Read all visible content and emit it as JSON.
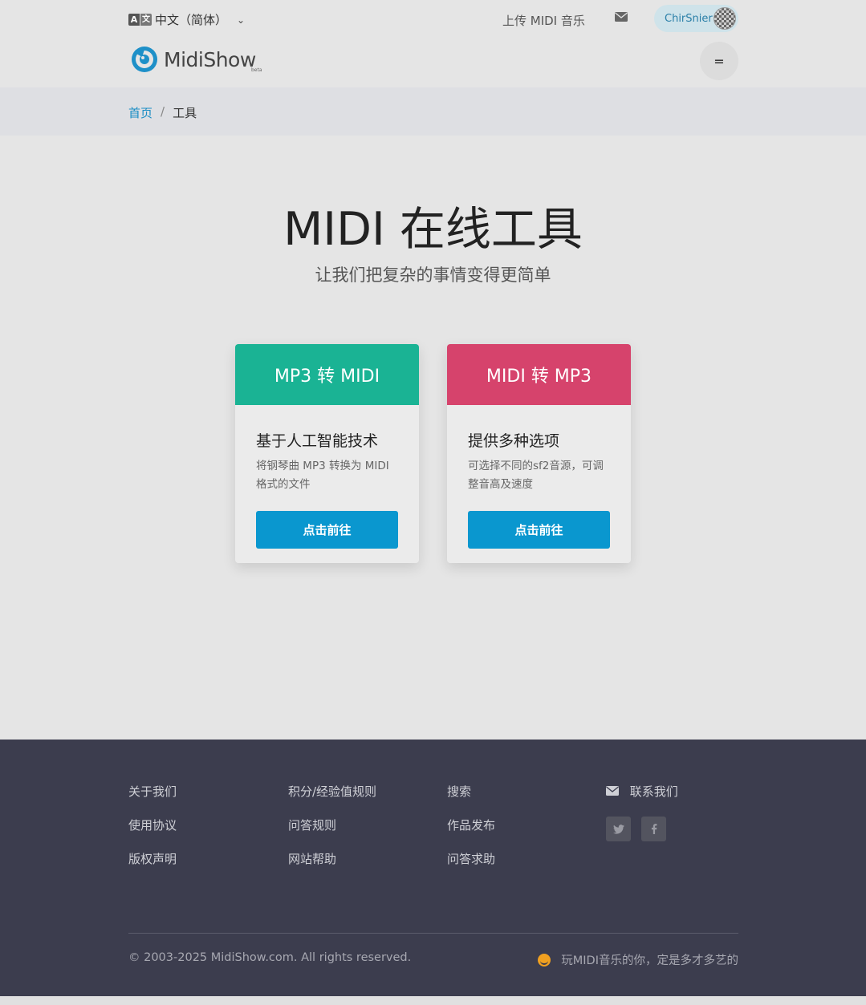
{
  "topbar": {
    "language": "中文（简体）",
    "upload_label": "上传 MIDI 音乐",
    "username": "ChirSnier"
  },
  "navbar": {
    "logo_text": "MidiShow",
    "logo_beta": "beta",
    "menu_symbol": "="
  },
  "breadcrumb": {
    "home": "首页",
    "separator": "/",
    "current": "工具"
  },
  "hero": {
    "title": "MIDI 在线工具",
    "subtitle": "让我们把复杂的事情变得更简单"
  },
  "cards": [
    {
      "header": "MP3 转 MIDI",
      "title": "基于人工智能技术",
      "description": "将钢琴曲 MP3 转换为 MIDI 格式的文件",
      "button": "点击前往",
      "color": "#1ab394"
    },
    {
      "header": "MIDI 转 MP3",
      "title": "提供多种选项",
      "description": "可选择不同的sf2音源，可调整音高及速度",
      "button": "点击前往",
      "color": "#d6436c"
    }
  ],
  "footer": {
    "col1": [
      "关于我们",
      "使用协议",
      "版权声明"
    ],
    "col2": [
      "积分/经验值规则",
      "问答规则",
      "网站帮助"
    ],
    "col3": [
      "搜索",
      "作品发布",
      "问答求助"
    ],
    "contact": "联系我们",
    "copyright": "© 2003-2025 MidiShow.com. All rights reserved.",
    "slogan": "玩MIDI音乐的你，定是多才多艺的"
  },
  "colors": {
    "accent_blue": "#0a97cf",
    "link_blue": "#1a8dc4",
    "footer_bg": "#3c3d4e"
  },
  "icons": [
    "language-icon",
    "chevron-down-icon",
    "mail-icon",
    "avatar",
    "menu-icon",
    "twitter-icon",
    "facebook-icon",
    "smile-icon"
  ]
}
